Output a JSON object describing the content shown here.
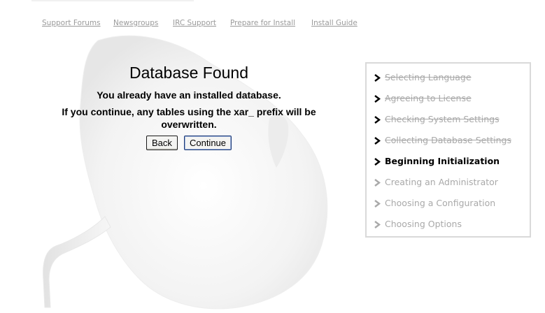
{
  "nav": {
    "links": [
      {
        "label": "Support Forums"
      },
      {
        "label": "Newsgroups"
      },
      {
        "label": "IRC Support"
      },
      {
        "label": "Prepare for Install"
      },
      {
        "label": "Install Guide"
      }
    ]
  },
  "main": {
    "title": "Database Found",
    "message_1": "You already have an installed database.",
    "message_2": "If you continue, any tables using the xar_ prefix will be overwritten.",
    "back_label": "Back",
    "continue_label": "Continue"
  },
  "steps": {
    "items": [
      {
        "label": "Selecting Language",
        "state": "done"
      },
      {
        "label": "Agreeing to License",
        "state": "done"
      },
      {
        "label": "Checking System Settings",
        "state": "done"
      },
      {
        "label": "Collecting Database Settings",
        "state": "done"
      },
      {
        "label": "Beginning Initialization",
        "state": "current"
      },
      {
        "label": "Creating an Administrator",
        "state": "todo"
      },
      {
        "label": "Choosing a Configuration",
        "state": "todo"
      },
      {
        "label": "Choosing Options",
        "state": "todo"
      }
    ]
  },
  "icons": {
    "step_arrow": "chevron-right-icon",
    "watermark": "mouse-logo-watermark"
  },
  "colors": {
    "text": "#000000",
    "muted": "#a9a9a9",
    "nav_link": "#9a9a9a",
    "box_border": "#d9d9d9"
  }
}
